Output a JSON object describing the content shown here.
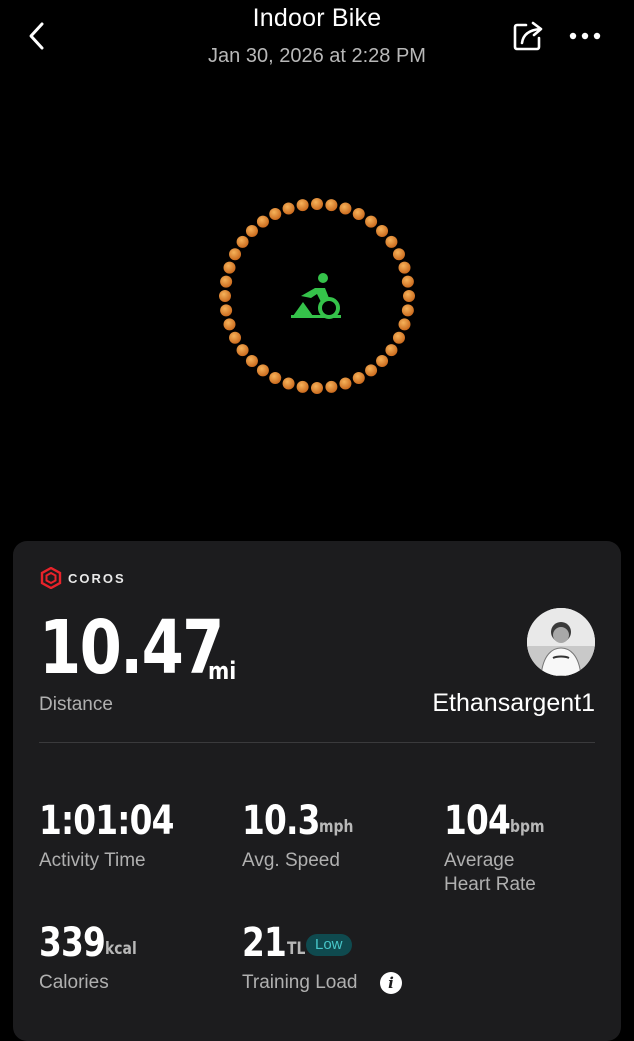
{
  "header": {
    "title": "Indoor Bike",
    "datetime": "Jan 30, 2026 at 2:28 PM",
    "back_icon": "chevron-left-icon",
    "share_icon": "share-icon",
    "more_icon": "more-horizontal-icon"
  },
  "hero": {
    "icon": "indoor-bike-icon",
    "ring_color": "#e8922a",
    "icon_color": "#35c24a"
  },
  "card": {
    "brand": "COROS",
    "brand_color": "#e8232a",
    "distance": {
      "value": "10.47",
      "unit": "mi",
      "label": "Distance"
    },
    "user": {
      "name": "Ethansargent1"
    },
    "stats": [
      {
        "value": "1:01:04",
        "unit": "",
        "label": "Activity Time"
      },
      {
        "value": "10.3",
        "unit": "mph",
        "label": "Avg. Speed"
      },
      {
        "value": "104",
        "unit": "bpm",
        "label": "Average",
        "label2": "Heart Rate"
      },
      {
        "value": "339",
        "unit": "kcal",
        "label": "Calories"
      },
      {
        "value": "21",
        "unit": "TL",
        "label": "Training Load",
        "badge": "Low"
      }
    ]
  }
}
